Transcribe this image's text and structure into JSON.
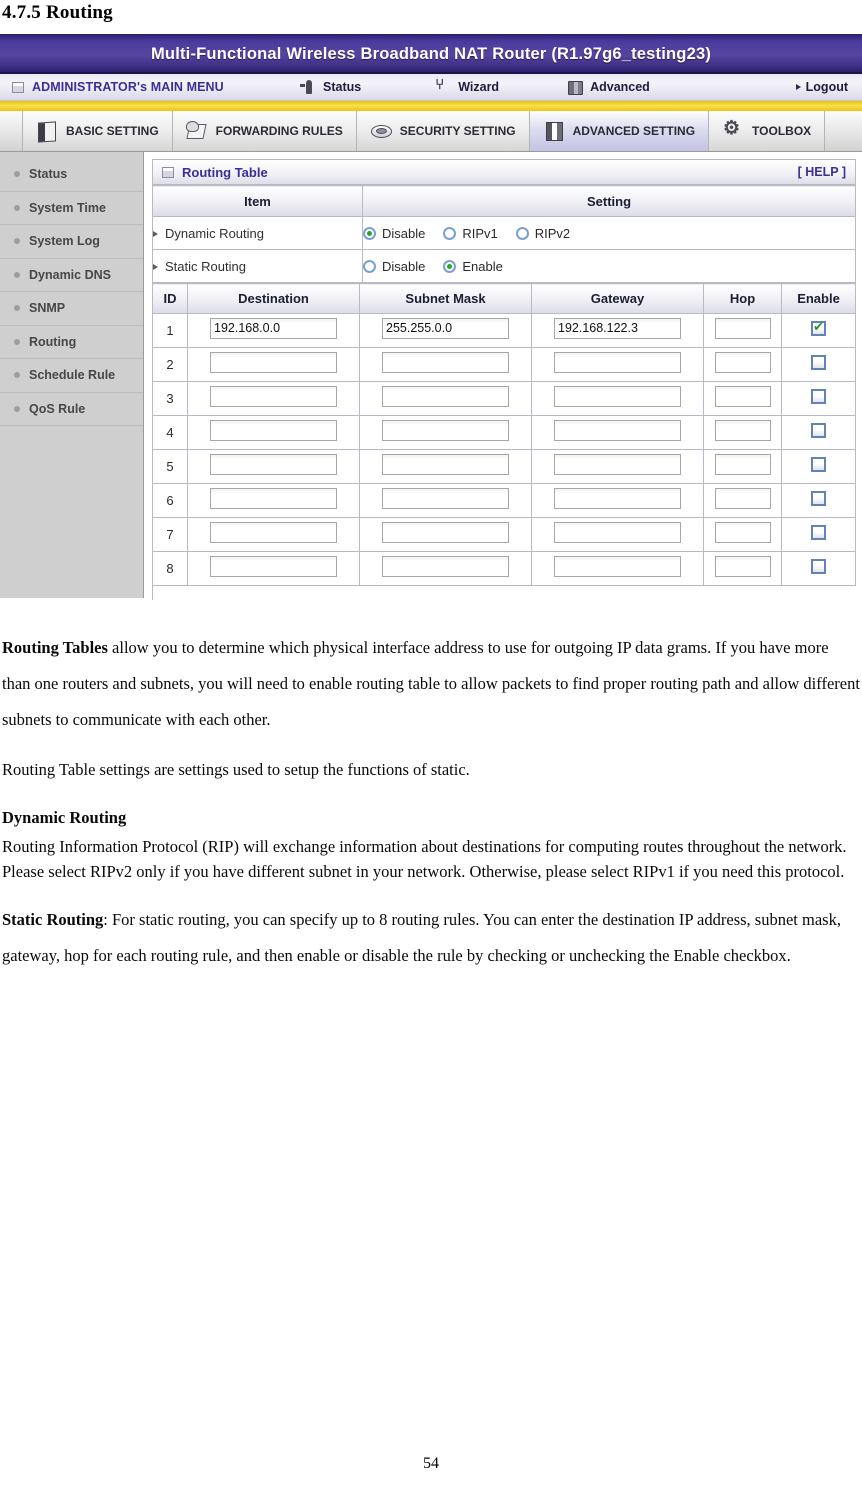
{
  "document": {
    "section_heading": "4.7.5 Routing",
    "page_number": "54"
  },
  "router_ui": {
    "title": "Multi-Functional Wireless Broadband NAT Router (R1.97g6_testing23)",
    "menubar": {
      "admin_label": "ADMINISTRATOR's MAIN MENU",
      "items": [
        {
          "label": "Status",
          "icon": "status-icon"
        },
        {
          "label": "Wizard",
          "icon": "wizard-icon"
        },
        {
          "label": "Advanced",
          "icon": "advanced-icon"
        }
      ],
      "logout_label": "Logout"
    },
    "tabs": [
      {
        "label": "BASIC SETTING",
        "icon": "book-icon",
        "active": false
      },
      {
        "label": "FORWARDING RULES",
        "icon": "forward-icon",
        "active": false
      },
      {
        "label": "SECURITY SETTING",
        "icon": "shield-icon",
        "active": false
      },
      {
        "label": "ADVANCED SETTING",
        "icon": "advanced-book-icon",
        "active": true
      },
      {
        "label": "TOOLBOX",
        "icon": "toolbox-gear-icon",
        "active": false
      }
    ],
    "sidebar": {
      "items": [
        {
          "label": "Status"
        },
        {
          "label": "System Time"
        },
        {
          "label": "System Log"
        },
        {
          "label": "Dynamic DNS"
        },
        {
          "label": "SNMP"
        },
        {
          "label": "Routing"
        },
        {
          "label": "Schedule Rule"
        },
        {
          "label": "QoS Rule"
        }
      ]
    },
    "panel": {
      "title": "Routing Table",
      "help_label": "[ HELP ]",
      "settings_headers": {
        "item": "Item",
        "setting": "Setting"
      },
      "settings_rows": [
        {
          "item": "Dynamic Routing",
          "options": [
            {
              "label": "Disable",
              "selected": true
            },
            {
              "label": "RIPv1",
              "selected": false
            },
            {
              "label": "RIPv2",
              "selected": false
            }
          ]
        },
        {
          "item": "Static Routing",
          "options": [
            {
              "label": "Disable",
              "selected": false
            },
            {
              "label": "Enable",
              "selected": true
            }
          ]
        }
      ],
      "grid_headers": [
        "ID",
        "Destination",
        "Subnet Mask",
        "Gateway",
        "Hop",
        "Enable"
      ],
      "grid_rows": [
        {
          "id": "1",
          "destination": "192.168.0.0",
          "subnet_mask": "255.255.0.0",
          "gateway": "192.168.122.3",
          "hop": "",
          "enable": true
        },
        {
          "id": "2",
          "destination": "",
          "subnet_mask": "",
          "gateway": "",
          "hop": "",
          "enable": false
        },
        {
          "id": "3",
          "destination": "",
          "subnet_mask": "",
          "gateway": "",
          "hop": "",
          "enable": false
        },
        {
          "id": "4",
          "destination": "",
          "subnet_mask": "",
          "gateway": "",
          "hop": "",
          "enable": false
        },
        {
          "id": "5",
          "destination": "",
          "subnet_mask": "",
          "gateway": "",
          "hop": "",
          "enable": false
        },
        {
          "id": "6",
          "destination": "",
          "subnet_mask": "",
          "gateway": "",
          "hop": "",
          "enable": false
        },
        {
          "id": "7",
          "destination": "",
          "subnet_mask": "",
          "gateway": "",
          "hop": "",
          "enable": false
        },
        {
          "id": "8",
          "destination": "",
          "subnet_mask": "",
          "gateway": "",
          "hop": "",
          "enable": false
        }
      ]
    },
    "colors": {
      "title_bar": "#4b3a9e",
      "accent_link": "#3a2f96",
      "yellow_band": "#f0d020",
      "sidebar_bg": "#cfcfcf",
      "radio_dot": "#2aa62a",
      "check_mark": "#1f9b1f"
    }
  },
  "prose": {
    "p1_lead": "Routing Tables",
    "p1_rest": " allow you to determine which physical interface address to use for outgoing IP data grams. If you have more than one routers and subnets, you will need to enable routing table to allow packets to find proper routing path and allow different subnets to communicate with each other.",
    "p2": "Routing Table settings are settings used to setup the functions of static.",
    "dynamic_heading": "Dynamic Routing",
    "dynamic_body": "Routing Information Protocol (RIP) will exchange information about destinations for computing routes throughout the network. Please select RIPv2 only if you have different subnet in your network. Otherwise, please select RIPv1 if you need this protocol.",
    "static_lead": "Static Routing",
    "static_rest": ": For static routing, you can specify up to 8 routing rules. You can enter the destination IP address, subnet mask, gateway, hop for each routing rule, and then enable or disable the rule by checking or unchecking the Enable checkbox."
  }
}
